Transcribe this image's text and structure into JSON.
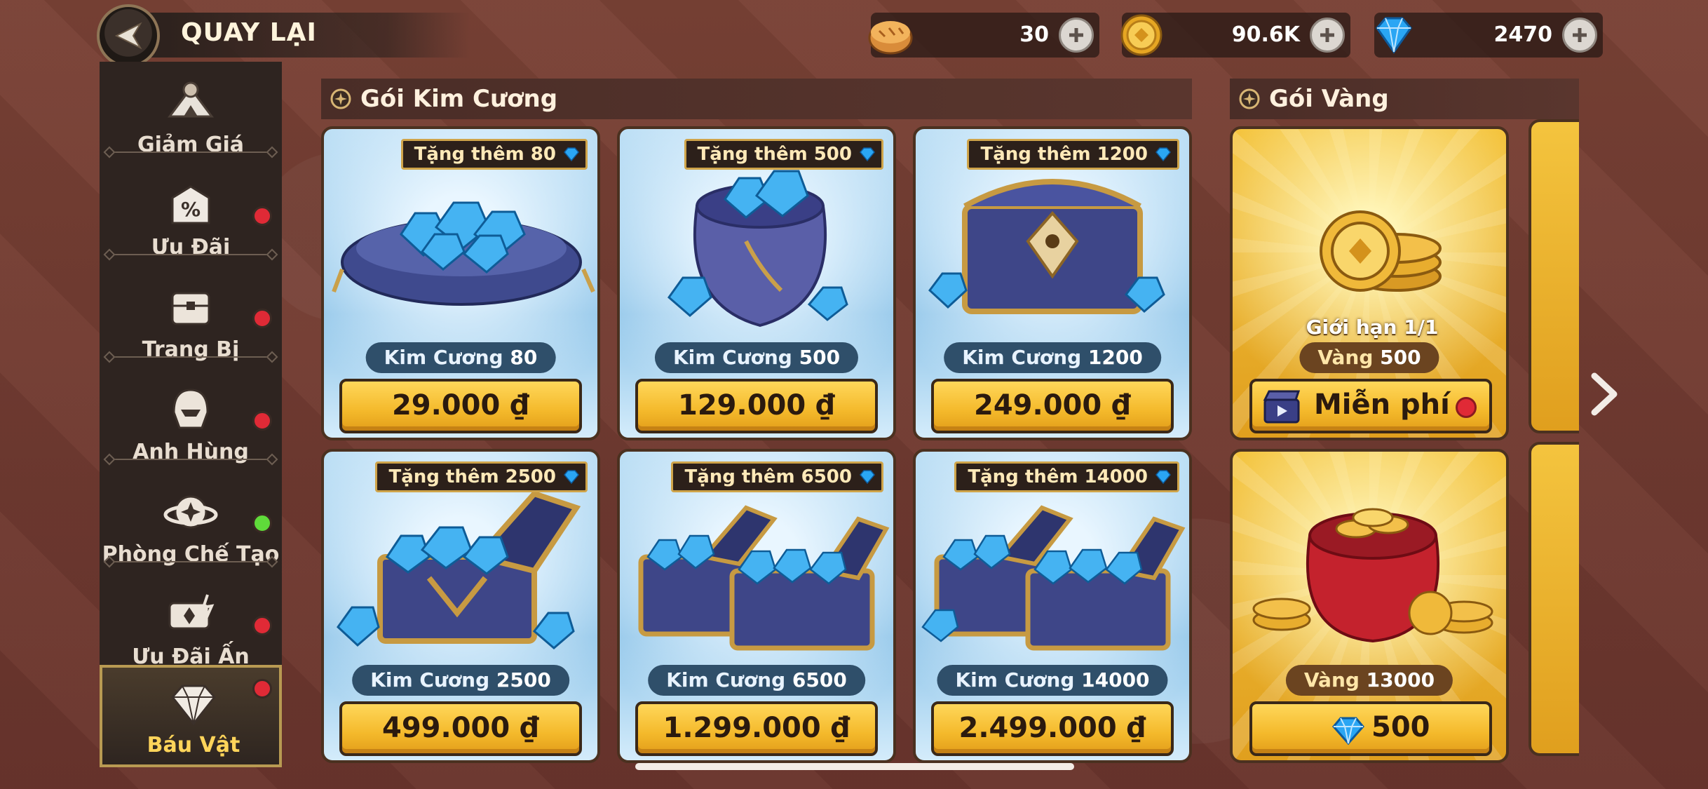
{
  "header": {
    "back_label": "QUAY LẠI",
    "currencies": [
      {
        "icon": "bread-icon",
        "value": "30"
      },
      {
        "icon": "gold-coin-icon",
        "value": "90.6K"
      },
      {
        "icon": "diamond-icon",
        "value": "2470"
      }
    ]
  },
  "sidebar": {
    "items": [
      {
        "label": "Giảm Giá",
        "icon": "discount-tent-icon",
        "badge": null
      },
      {
        "label": "Ưu Đãi",
        "icon": "percent-tag-icon",
        "badge": "red"
      },
      {
        "label": "Trang Bị",
        "icon": "chest-icon",
        "badge": "red"
      },
      {
        "label": "Anh Hùng",
        "icon": "helmet-icon",
        "badge": "red"
      },
      {
        "label": "Phòng Chế Tạo",
        "icon": "crafting-planet-icon",
        "badge": "green"
      },
      {
        "label": "Ưu Đãi Ấn",
        "icon": "ticket-icon",
        "badge": "red"
      },
      {
        "label": "Báu Vật",
        "icon": "treasure-diamond-icon",
        "badge": "red",
        "active": true
      }
    ]
  },
  "diamond_section": {
    "title": "Gói Kim Cương",
    "packs": [
      {
        "bonus": "Tặng thêm 80",
        "name": "Kim Cương",
        "amount": "80",
        "price": "29.000 ₫",
        "art": "gem-pillow"
      },
      {
        "bonus": "Tặng thêm 500",
        "name": "Kim Cương",
        "amount": "500",
        "price": "129.000 ₫",
        "art": "gem-bag"
      },
      {
        "bonus": "Tặng thêm 1200",
        "name": "Kim Cương",
        "amount": "1200",
        "price": "249.000 ₫",
        "art": "gem-chest-closed"
      },
      {
        "bonus": "Tặng thêm 2500",
        "name": "Kim Cương",
        "amount": "2500",
        "price": "499.000 ₫",
        "art": "gem-chest-open"
      },
      {
        "bonus": "Tặng thêm 6500",
        "name": "Kim Cương",
        "amount": "6500",
        "price": "1.299.000 ₫",
        "art": "gem-chests-double"
      },
      {
        "bonus": "Tặng thêm 14000",
        "name": "Kim Cương",
        "amount": "14000",
        "price": "2.499.000 ₫",
        "art": "gem-chests-double"
      }
    ]
  },
  "gold_section": {
    "title": "Gói Vàng",
    "packs": [
      {
        "limit": "Giới hạn 1/1",
        "name": "Vàng",
        "amount": "500",
        "action": "Miễn phí"
      },
      {
        "name": "Vàng",
        "amount": "13000",
        "gem_price": "500"
      }
    ]
  },
  "colors": {
    "background": "#6e3a32",
    "sidebar": "#2e2420",
    "price_button": "#f4b92b",
    "badge_red": "#e02a36",
    "badge_green": "#5fdb3a"
  }
}
